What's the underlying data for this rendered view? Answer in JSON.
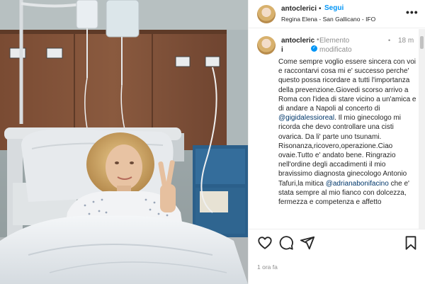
{
  "header": {
    "username": "antoclerici",
    "dot": "•",
    "follow_label": "Segui",
    "location": "Regina Elena - San Gallicano - IFO",
    "more_icon": "more-horizontal-icon"
  },
  "caption": {
    "username": "antoclerici",
    "verified_icon": "verified-badge-icon",
    "dot": "•",
    "modified_label": "Elemento modificato",
    "time": "18 m",
    "text_before": "Come sempre voglio essere sincera con voi e raccontarvi cosa mi e' successo perche' questo possa ricordare a tutti l'importanza della prevenzione.Giovedi scorso arrivo a Roma con l'idea di stare vicino a un'amica e di andare a Napoli al concerto di ",
    "mention_1": "@gigidalessioreal",
    "text_middle": ". Il mio ginecologo mi ricorda che devo controllare una cisti ovarica. Da li' parte uno tsunami. Risonanza,ricovero,operazione.Ciao ovaie.Tutto e' andato bene. Ringrazio nell'ordine degli accadimenti il mio bravissimo diagnosta ginecologo Antonio Tafuri,la mitica ",
    "mention_2": "@adrianabonifacino",
    "text_after": " che e' stata sempre al mio fianco con dolcezza, fermezza e competenza e affetto"
  },
  "actions": {
    "like_icon": "heart-icon",
    "comment_icon": "comment-icon",
    "share_icon": "share-icon",
    "save_icon": "bookmark-icon"
  },
  "footer": {
    "time": "1 ora fa"
  },
  "colors": {
    "accent": "#0095f6",
    "mention": "#00376b",
    "muted": "#8e8e8e",
    "text": "#262626"
  }
}
